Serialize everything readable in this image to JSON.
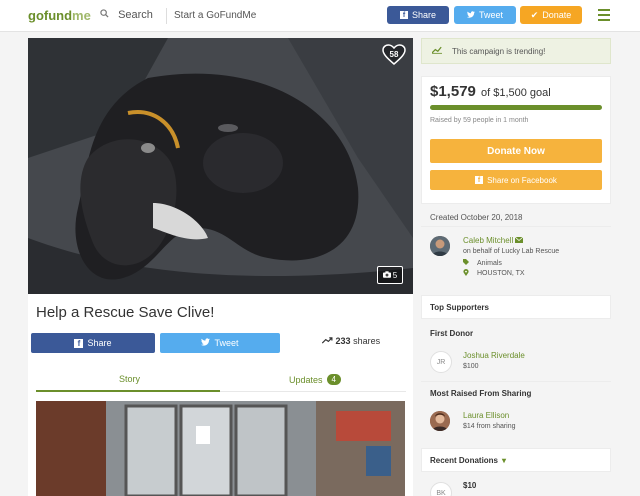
{
  "header": {
    "logo_main": "gofund",
    "logo_suffix": "me",
    "search_label": "Search",
    "start_label": "Start a GoFundMe",
    "share_label": "Share",
    "tweet_label": "Tweet",
    "donate_label": "Donate",
    "icons": {
      "search": "search-icon",
      "facebook": "facebook-icon",
      "twitter": "twitter-icon",
      "check": "check-icon",
      "menu": "hamburger-menu-icon"
    }
  },
  "hero": {
    "heart_count": "58",
    "photo_count": "5"
  },
  "campaign": {
    "title": "Help a Rescue Save Clive!",
    "share_label": "Share",
    "tweet_label": "Tweet",
    "shares_count": "233",
    "shares_label": "shares",
    "tabs": {
      "story": "Story",
      "updates": "Updates",
      "updates_count": "4"
    }
  },
  "sidebar": {
    "trending": "This campaign is trending!",
    "raised_amount": "$1,579",
    "goal_text": "of $1,500 goal",
    "progress": 1.0,
    "raised_by": "Raised by 59 people in 1 month",
    "donate_now": "Donate Now",
    "share_facebook": "Share on Facebook",
    "created": "Created October 20, 2018",
    "organizer": {
      "name": "Caleb Mitchell",
      "behalf": "on behalf of Lucky Lab Rescue",
      "category": "Animals",
      "location": "HOUSTON, TX"
    },
    "top_supporters": "Top Supporters",
    "first_donor": {
      "heading": "First Donor",
      "initials": "JR",
      "name": "Joshua Riverdale",
      "amount": "$100"
    },
    "most_raised": {
      "heading": "Most Raised From Sharing",
      "name": "Laura Ellison",
      "amount": "$14 from sharing"
    },
    "recent_donations": "Recent Donations",
    "recent_first": {
      "initials": "BK",
      "amount": "$10"
    }
  },
  "colors": {
    "brand_green": "#6b8f2b",
    "facebook": "#3b5998",
    "twitter": "#55acee",
    "donate_orange": "#f6b33d"
  }
}
